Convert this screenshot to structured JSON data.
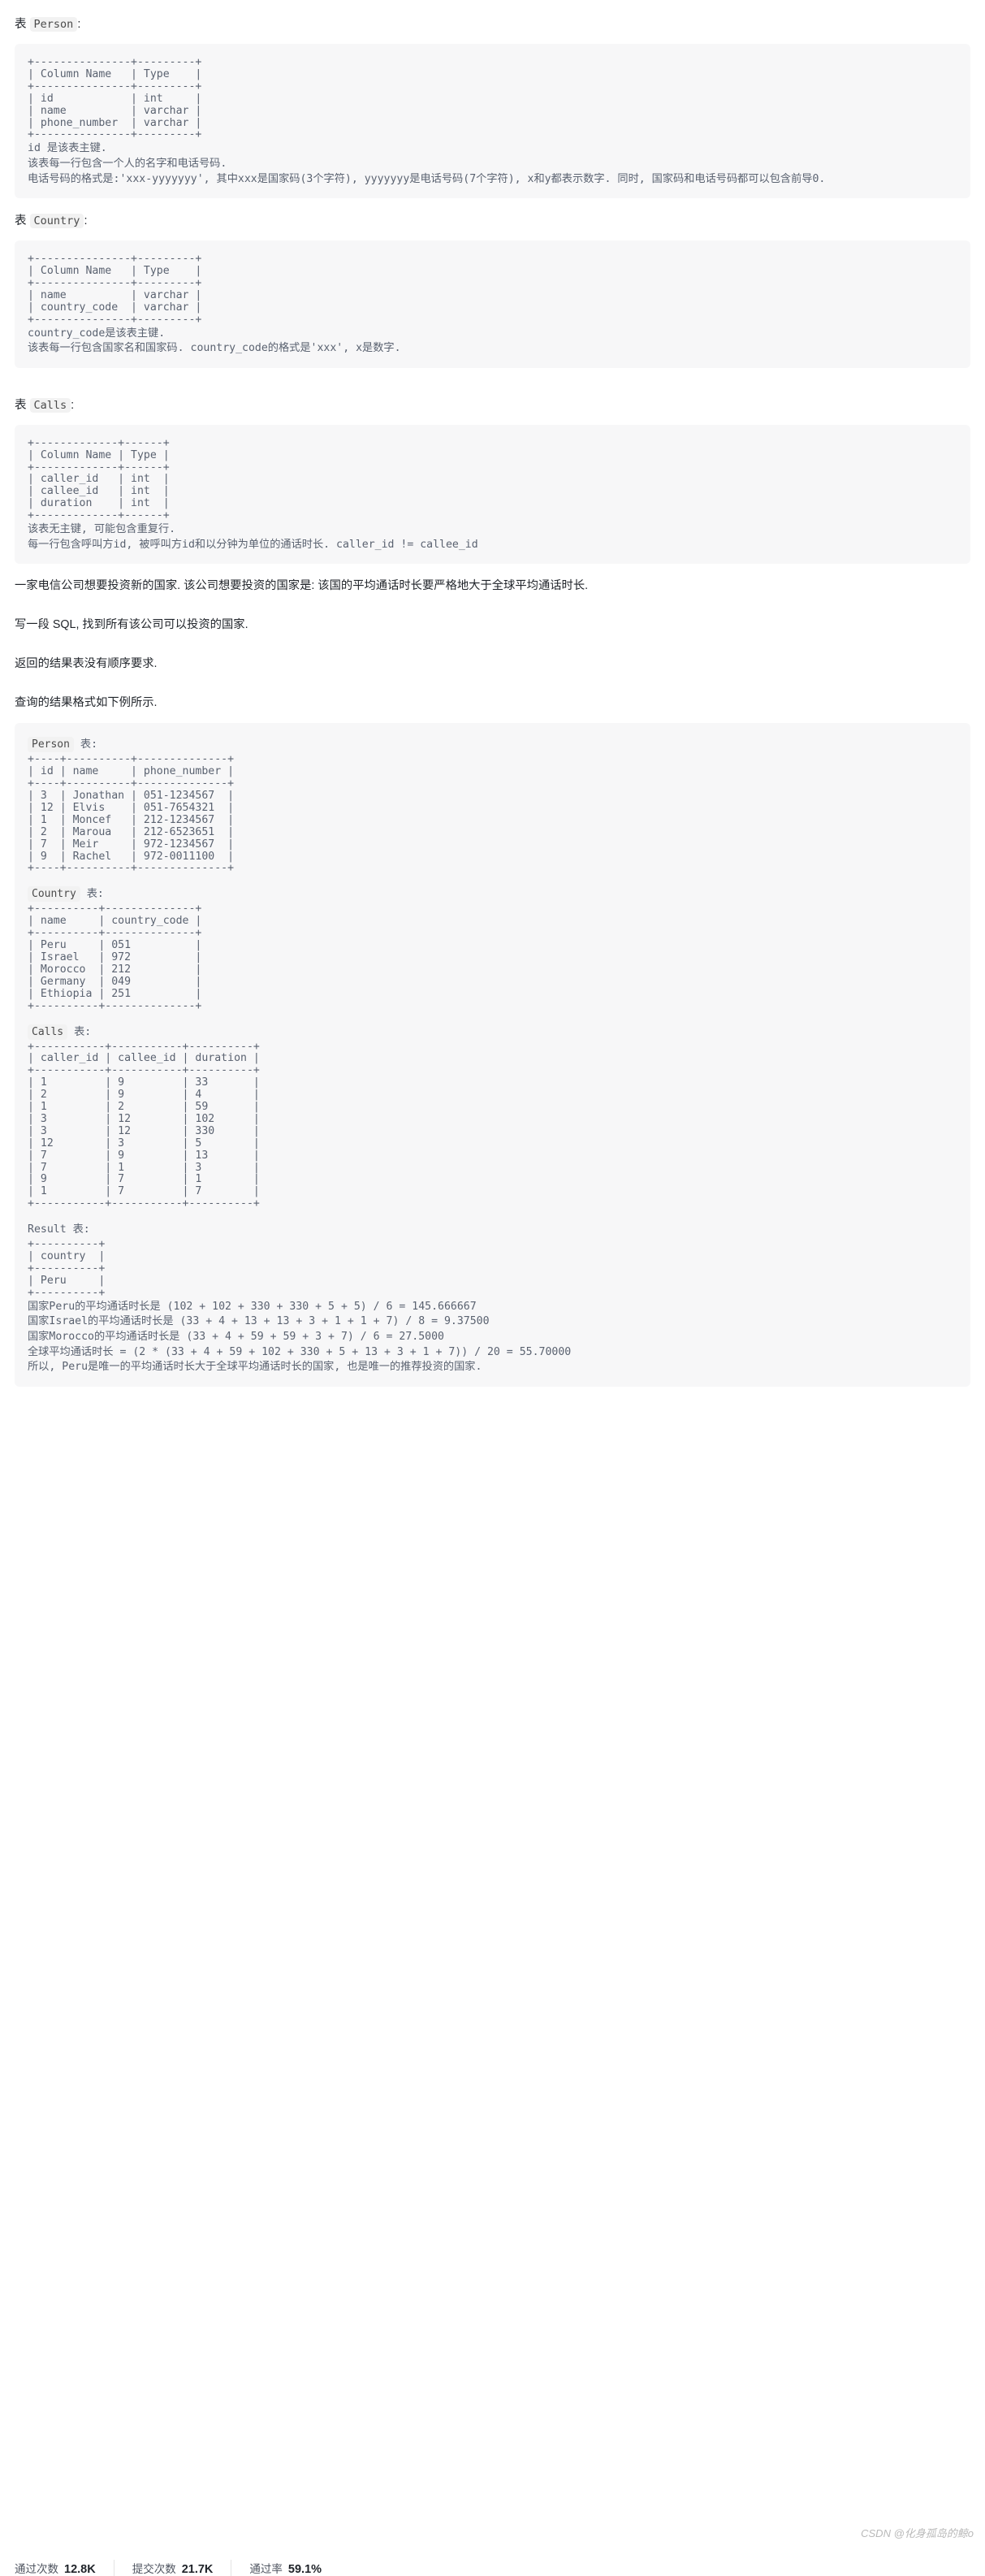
{
  "sections": {
    "person": {
      "heading_prefix": "表",
      "heading_code": "Person",
      "heading_suffix": ":",
      "schema_ascii": "+---------------+---------+\n| Column Name   | Type    |\n+---------------+---------+\n| id            | int     |\n| name          | varchar |\n| phone_number  | varchar |\n+---------------+---------+",
      "desc": "id 是该表主键.\n该表每一行包含一个人的名字和电话号码.\n电话号码的格式是:'xxx-yyyyyyy', 其中xxx是国家码(3个字符), yyyyyyy是电话号码(7个字符), x和y都表示数字. 同时, 国家码和电话号码都可以包含前导0."
    },
    "country": {
      "heading_prefix": "表",
      "heading_code": "Country",
      "heading_suffix": ":",
      "schema_ascii": "+---------------+---------+\n| Column Name   | Type    |\n+---------------+---------+\n| name          | varchar |\n| country_code  | varchar |\n+---------------+---------+",
      "desc": "country_code是该表主键.\n该表每一行包含国家名和国家码. country_code的格式是'xxx', x是数字."
    },
    "calls": {
      "heading_prefix": "表",
      "heading_code": "Calls",
      "heading_suffix": ":",
      "schema_ascii": "+-------------+------+\n| Column Name | Type |\n+-------------+------+\n| caller_id   | int  |\n| callee_id   | int  |\n| duration    | int  |\n+-------------+------+",
      "desc": "该表无主键, 可能包含重复行.\n每一行包含呼叫方id, 被呼叫方id和以分钟为单位的通话时长. caller_id != callee_id"
    }
  },
  "problem": {
    "p1": "一家电信公司想要投资新的国家. 该公司想要投资的国家是: 该国的平均通话时长要严格地大于全球平均通话时长.",
    "p2": "写一段 SQL, 找到所有该公司可以投资的国家.",
    "p3": "返回的结果表没有顺序要求.",
    "p4": "查询的结果格式如下例所示."
  },
  "example": {
    "person_label_code": "Person",
    "person_label_suffix": "表:",
    "person_ascii": "+----+----------+--------------+\n| id | name     | phone_number |\n+----+----------+--------------+\n| 3  | Jonathan | 051-1234567  |\n| 12 | Elvis    | 051-7654321  |\n| 1  | Moncef   | 212-1234567  |\n| 2  | Maroua   | 212-6523651  |\n| 7  | Meir     | 972-1234567  |\n| 9  | Rachel   | 972-0011100  |\n+----+----------+--------------+",
    "country_label_code": "Country",
    "country_label_suffix": "表:",
    "country_ascii": "+----------+--------------+\n| name     | country_code |\n+----------+--------------+\n| Peru     | 051          |\n| Israel   | 972          |\n| Morocco  | 212          |\n| Germany  | 049          |\n| Ethiopia | 251          |\n+----------+--------------+",
    "calls_label_code": "Calls",
    "calls_label_suffix": "表:",
    "calls_ascii": "+-----------+-----------+----------+\n| caller_id | callee_id | duration |\n+-----------+-----------+----------+\n| 1         | 9         | 33       |\n| 2         | 9         | 4        |\n| 1         | 2         | 59       |\n| 3         | 12        | 102      |\n| 3         | 12        | 330      |\n| 12        | 3         | 5        |\n| 7         | 9         | 13       |\n| 7         | 1         | 3        |\n| 9         | 7         | 1        |\n| 1         | 7         | 7        |\n+-----------+-----------+----------+",
    "result_label_code": "Result",
    "result_label_suffix": "表:",
    "result_ascii": "+----------+\n| country  |\n+----------+\n| Peru     |\n+----------+",
    "explanation": "国家Peru的平均通话时长是 (102 + 102 + 330 + 330 + 5 + 5) / 6 = 145.666667\n国家Israel的平均通话时长是 (33 + 4 + 13 + 13 + 3 + 1 + 1 + 7) / 8 = 9.37500\n国家Morocco的平均通话时长是 (33 + 4 + 59 + 59 + 3 + 7) / 6 = 27.5000\n全球平均通话时长 = (2 * (33 + 4 + 59 + 102 + 330 + 5 + 13 + 3 + 1 + 7)) / 20 = 55.70000\n所以, Peru是唯一的平均通话时长大于全球平均通话时长的国家, 也是唯一的推荐投资的国家."
  },
  "footer": {
    "stats": [
      {
        "label": "通过次数",
        "value": "12.8K"
      },
      {
        "label": "提交次数",
        "value": "21.7K"
      },
      {
        "label": "通过率",
        "value": "59.1%"
      }
    ],
    "watermark": "CSDN @化身孤岛的鲸o"
  }
}
